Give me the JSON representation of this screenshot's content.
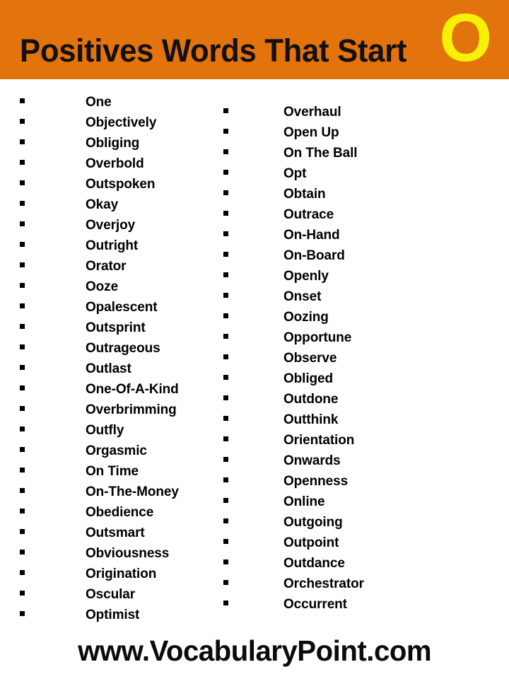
{
  "header": {
    "title": "Positives Words That Start",
    "letter": "O",
    "band_color": "#e2730d",
    "title_color": "#111111",
    "letter_color": "#f7f107"
  },
  "columns": {
    "left": [
      "One",
      "Objectively",
      "Obliging",
      "Overbold",
      "Outspoken",
      "Okay",
      "Overjoy",
      "Outright",
      "Orator",
      "Ooze",
      "Opalescent",
      "Outsprint",
      "Outrageous",
      "Outlast",
      "One-Of-A-Kind",
      "Overbrimming",
      "Outfly",
      "Orgasmic",
      "On Time",
      "On-The-Money",
      "Obedience",
      "Outsmart",
      "Obviousness",
      "Origination",
      "Oscular",
      "Optimist"
    ],
    "right": [
      "Overhaul",
      "Open Up",
      "On The Ball",
      "Opt",
      "Obtain",
      "Outrace",
      "On-Hand",
      "On-Board",
      "Openly",
      "Onset",
      "Oozing",
      "Opportune",
      "Observe",
      "Obliged",
      "Outdone",
      "Outthink",
      "Orientation",
      "Onwards",
      "Openness",
      "Online",
      "Outgoing",
      "Outpoint",
      "Outdance",
      "Orchestrator",
      "Occurrent"
    ]
  },
  "footer": {
    "website": "www.VocabularyPoint.com"
  }
}
